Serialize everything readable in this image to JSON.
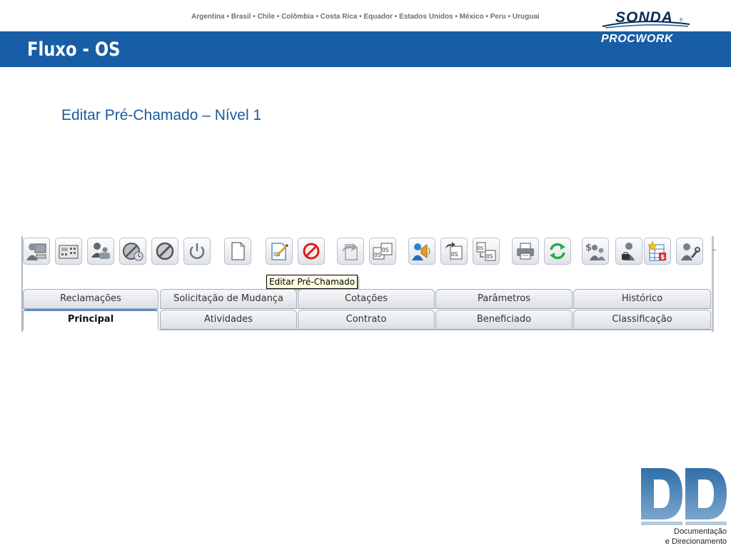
{
  "header": {
    "countries": "Argentina • Brasil • Chile • Colômbia • Costa Rica • Equador • Estados Unidos • México • Peru • Uruguai",
    "title": "Fluxo - OS",
    "logo_top": "SONDA",
    "logo_bottom": "PROCWORK",
    "banner_color": "#175ea6"
  },
  "slide": {
    "subtitle": "Editar Pré-Chamado – Nível 1"
  },
  "toolbar": {
    "buttons": [
      "user-computer-icon",
      "calculator-icon",
      "user-group-icon",
      "canceled-clock-icon",
      "cancel-circle-icon",
      "power-icon",
      "new-document-icon",
      "edit-document-icon",
      "forbidden-icon",
      "forward-document-icon",
      "os-copy-icon",
      "announce-user-icon",
      "os-return-icon",
      "os-transfer-icon",
      "printer-icon",
      "refresh-icon",
      "finance-users-icon",
      "user-briefcase-icon",
      "spreadsheet-star-icon",
      "user-tools-icon"
    ],
    "tooltip": "Editar Pré-Chamado"
  },
  "tabs": {
    "row1": [
      "Reclamações",
      "Solicitação de Mudança",
      "Cotações",
      "Parâmetros",
      "Histórico"
    ],
    "row2": [
      "Principal",
      "Atividades",
      "Contrato",
      "Beneficiado",
      "Classificação"
    ],
    "active": "Principal"
  },
  "footer_logo": {
    "letters": "DD",
    "caption_line1": "Documentação",
    "caption_line2": "e Direcionamento"
  }
}
